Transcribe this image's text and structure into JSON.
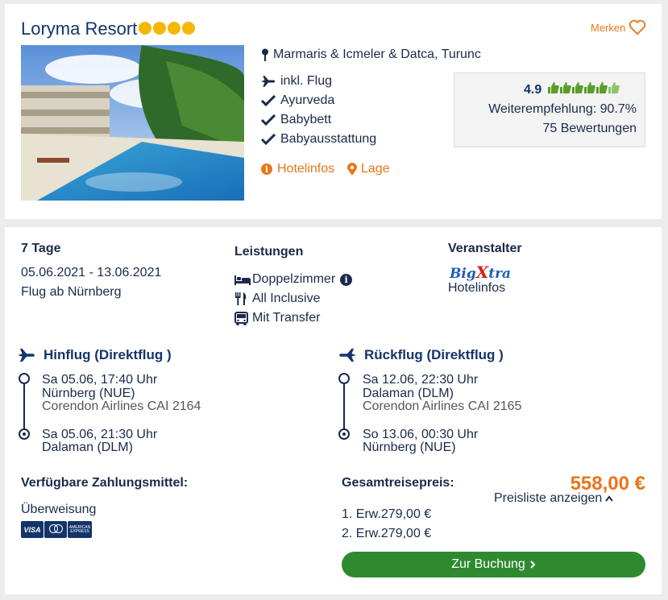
{
  "hotel": {
    "name": "Loryma Resort",
    "stars": 4,
    "merken_label": "Merken",
    "location": "Marmaris & Icmeler & Datca, Turunc",
    "features": [
      "inkl. Flug",
      "Ayurveda",
      "Babybett",
      "Babyausstattung"
    ],
    "links": {
      "hotelinfos": "Hotelinfos",
      "lage": "Lage"
    },
    "rating": {
      "score": "4.9",
      "thumbs_filled": 6,
      "recommendation": "Weiterempfehlung: 90.7%",
      "reviews": "75 Bewertungen"
    }
  },
  "offer": {
    "duration": "7 Tage",
    "dates": "05.06.2021 - 13.06.2021",
    "departure": "Flug ab Nürnberg",
    "services_title": "Leistungen",
    "services": [
      "Doppelzimmer",
      "All Inclusive",
      "Mit Transfer"
    ],
    "operator_title": "Veranstalter",
    "operator_logo": "BigXtra",
    "operator_link": "Hotelinfos"
  },
  "outbound": {
    "title": "Hinflug (Direktflug )",
    "depart_time": "Sa 05.06, 17:40 Uhr",
    "depart_airport": "Nürnberg (NUE)",
    "airline": "Corendon Airlines CAI 2164",
    "arrive_time": "Sa 05.06, 21:30 Uhr",
    "arrive_airport": "Dalaman (DLM)"
  },
  "return": {
    "title": "Rückflug (Direktflug )",
    "depart_time": "Sa 12.06, 22:30 Uhr",
    "depart_airport": "Dalaman (DLM)",
    "airline": "Corendon Airlines CAI 2165",
    "arrive_time": "So 13.06, 00:30 Uhr",
    "arrive_airport": "Nürnberg (NUE)"
  },
  "payment": {
    "title": "Verfügbare Zahlungsmittel:",
    "method": "Überweisung",
    "cards": [
      "VISA",
      "Mastercard",
      "American Express"
    ]
  },
  "price": {
    "title": "Gesamtreisepreis:",
    "total": "558,00 €",
    "toggle_label": "Preisliste anzeigen",
    "lines": [
      "1. Erw.279,00 €",
      "2. Erw.279,00 €"
    ],
    "cta_label": "Zur Buchung"
  },
  "colors": {
    "accent": "#e8761a",
    "navy": "#1a2a4a",
    "cta": "#2f8a2f",
    "star": "#f5b800",
    "thumb": "#5a9e2a"
  }
}
